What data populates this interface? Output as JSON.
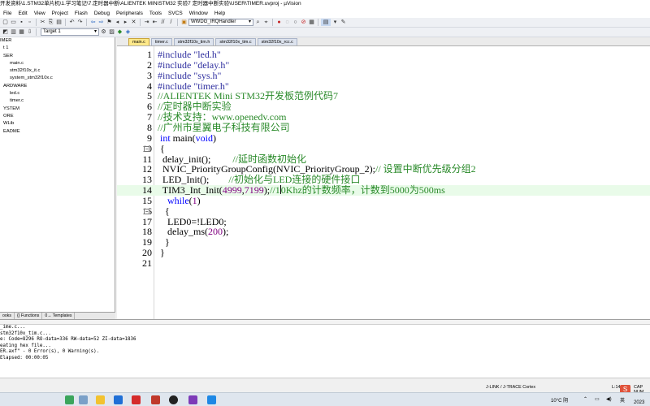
{
  "window": {
    "title": "开发资料\\1.STM32单片机\\1.学习笔记\\7.定时器中断\\ALIENTEK MINISTM32 实验7 定时器中断实验\\USER\\TIMER.uvproj - µVision"
  },
  "menu": [
    "File",
    "Edit",
    "View",
    "Project",
    "Flash",
    "Debug",
    "Peripherals",
    "Tools",
    "SVCS",
    "Window",
    "Help"
  ],
  "toolbar": {
    "target": "Target 1",
    "function_combo": "WWDG_IRQHandler"
  },
  "project_tree": [
    "IMER",
    "t 1",
    "SER",
    "main.c",
    "stm32f10x_it.c",
    "system_stm32f10x.c",
    "ARDWARE",
    "led.c",
    "timer.c",
    "YSTEM",
    "ORE",
    "WLib",
    "EADME"
  ],
  "left_tabs": [
    "ooks",
    "{} Functions",
    "0→ Templates"
  ],
  "editor_tabs": [
    "main.c",
    "timer.c",
    "stm32f10x_tim.h",
    "stm32f10x_tim.c",
    "stm32f10x_rcc.c"
  ],
  "code_lines": [
    {
      "n": "1",
      "text": "#include \"led.h\"",
      "cls": "pp"
    },
    {
      "n": "2",
      "text": "#include \"delay.h\"",
      "cls": "pp"
    },
    {
      "n": "3",
      "text": "#include \"sys.h\"",
      "cls": "pp"
    },
    {
      "n": "4",
      "text": "#include \"timer.h\"",
      "cls": "pp"
    },
    {
      "n": "5",
      "text": "//ALIENTEK Mini STM32开发板范例代码7",
      "cls": "cm"
    },
    {
      "n": "6",
      "text": "//定时器中断实验",
      "cls": "cm"
    },
    {
      "n": "7",
      "text": "//技术支持：www.openedv.com",
      "cls": "cm"
    },
    {
      "n": "8",
      "text": "//广州市星翼电子科技有限公司",
      "cls": "cm"
    },
    {
      "n": "9",
      "text": " int main(void)",
      "cls": "fn"
    },
    {
      "n": "10",
      "text": " {",
      "cls": ""
    },
    {
      "n": "11",
      "text": "  delay_init();",
      "cls": "",
      "comment": "//延时函数初始化",
      "cpad": "         "
    },
    {
      "n": "12",
      "text": "  NVIC_PriorityGroupConfig(NVIC_PriorityGroup_2);",
      "cls": "",
      "comment": "// 设置中断优先级分组2",
      "cpad": ""
    },
    {
      "n": "13",
      "text": "  LED_Init();",
      "cls": "",
      "comment": "//初始化与LED连接的硬件接口",
      "cpad": "        "
    },
    {
      "n": "14",
      "text": "  TIM3_Int_Init(4999,7199);",
      "cls": "tim",
      "comment": "//10Khz的计数频率，计数到5000为500ms",
      "cpad": ""
    },
    {
      "n": "15",
      "text": "    while(1)",
      "cls": "while"
    },
    {
      "n": "16",
      "text": "   {",
      "cls": ""
    },
    {
      "n": "17",
      "text": "    LED0=!LED0;",
      "cls": ""
    },
    {
      "n": "18",
      "text": "    delay_ms(200);",
      "cls": "delay"
    },
    {
      "n": "19",
      "text": "   }",
      "cls": ""
    },
    {
      "n": "20",
      "text": " }",
      "cls": ""
    },
    {
      "n": "21",
      "text": "",
      "cls": ""
    }
  ],
  "build_output": [
    "_ime.c...",
    "stm32f10x_tim.c...",
    "e: Code=8296 RO-data=336 RW-data=52 ZI-data=1836",
    "eating hex file...",
    "ER.axf\" - 0 Error(s), 0 Warning(s).",
    "Elapsed:  00:00:05"
  ],
  "status": {
    "debugger": "J-LINK / J-TRACE Cortex",
    "position": "L:14 C:31",
    "caps": "CAP NUM"
  },
  "ime": {
    "label": "S"
  },
  "tray": {
    "weather": "10°C 阴",
    "clock": "2023"
  },
  "colors": {
    "accent": "#ffe98a",
    "current_line": "#e9fbe9",
    "comment": "#2a8a2a",
    "preprocessor": "#3030a0",
    "keyword": "#0000ff",
    "number": "#800080"
  }
}
